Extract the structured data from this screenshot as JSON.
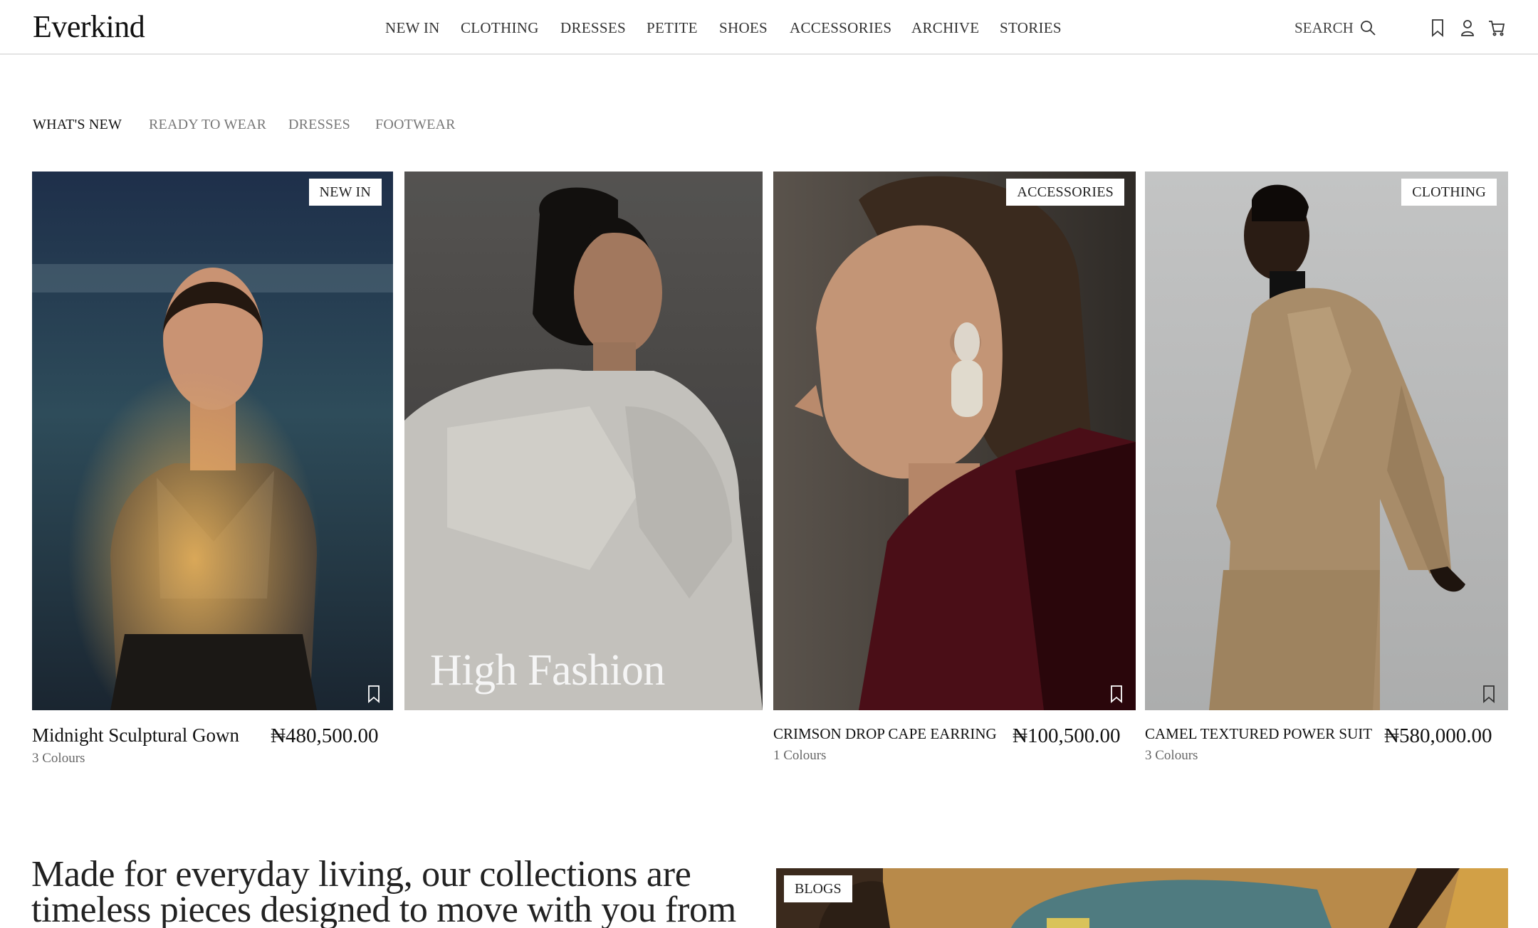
{
  "brand": {
    "logo": "Everkind"
  },
  "nav": {
    "items": [
      "NEW IN",
      "CLOTHING",
      "DRESSES",
      "PETITE",
      "SHOES",
      "ACCESSORIES",
      "ARCHIVE",
      "STORIES"
    ],
    "search_label": "SEARCH",
    "icons": [
      "search-icon",
      "bookmark-icon",
      "user-icon",
      "cart-icon"
    ]
  },
  "tabs": {
    "items": [
      "WHAT'S NEW",
      "READY TO WEAR",
      "DRESSES",
      "FOOTWEAR"
    ],
    "active": "WHAT'S NEW"
  },
  "products": [
    {
      "badge": "NEW IN",
      "name": "Midnight Sculptural Gown",
      "colors": "3 Colours",
      "price": "₦480,500.00"
    },
    {
      "overlay_title": "High Fashion"
    },
    {
      "badge": "ACCESSORIES",
      "name": "CRIMSON DROP  CAPE EARRING",
      "colors": "1 Colours",
      "price": "₦100,500.00"
    },
    {
      "badge": "CLOTHING",
      "name": "CAMEL TEXTURED POWER SUIT",
      "colors": "3 Colours",
      "price": "₦580,000.00"
    }
  ],
  "story": {
    "tagline": "Made for everyday living, our collections are timeless pieces designed to move with you from season to",
    "blog_badge": "BLOGS"
  }
}
